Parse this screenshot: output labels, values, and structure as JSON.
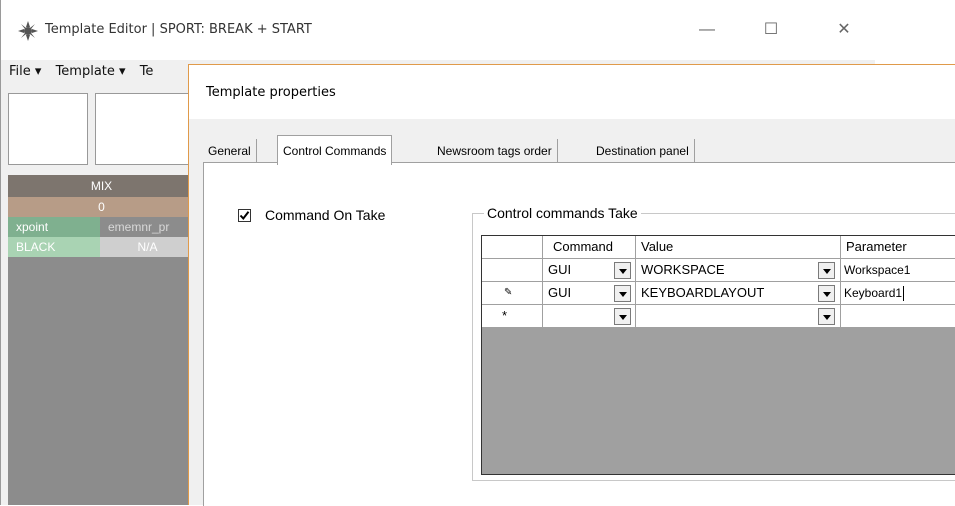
{
  "window": {
    "title": "Template Editor | SPORT: BREAK + START",
    "minimize": "—",
    "maximize": "☐",
    "close": "✕"
  },
  "menu": {
    "items": [
      "File ▾",
      "Template ▾",
      "Te"
    ]
  },
  "mix": {
    "header": "MIX",
    "number": "0",
    "rows": [
      {
        "left": "xpoint",
        "right": "ememnr_pr",
        "left_bg": "#7fb08f",
        "right_bg": "#8c8c8c",
        "right_color": "#d8d8d8"
      },
      {
        "left": "BLACK",
        "right": "N/A",
        "left_bg": "#a9d3b3",
        "right_bg": "#cfcfcf",
        "right_color": "#ffffff"
      }
    ]
  },
  "dialog": {
    "title": "Template properties",
    "tabs": [
      "General",
      "Control Commands",
      "Newsroom tags order",
      "Destination panel"
    ],
    "active_tab": "Control Commands",
    "checkbox_label": "Command On Take",
    "checkbox_checked": true,
    "group_title": "Control commands Take",
    "grid": {
      "headers": [
        "",
        "Command",
        "Value",
        "Parameter"
      ],
      "rows": [
        {
          "marker": "",
          "command": "GUI",
          "value": "WORKSPACE",
          "parameter": "Workspace1"
        },
        {
          "marker": "✎",
          "command": "GUI",
          "value": "KEYBOARDLAYOUT",
          "parameter": "Keyboard1"
        },
        {
          "marker": "*",
          "command": "",
          "value": "",
          "parameter": ""
        }
      ]
    }
  },
  "colors": {
    "dialog_border": "#e09a4a",
    "mix_header": "#7d756e",
    "mix_number": "#b79c87"
  }
}
